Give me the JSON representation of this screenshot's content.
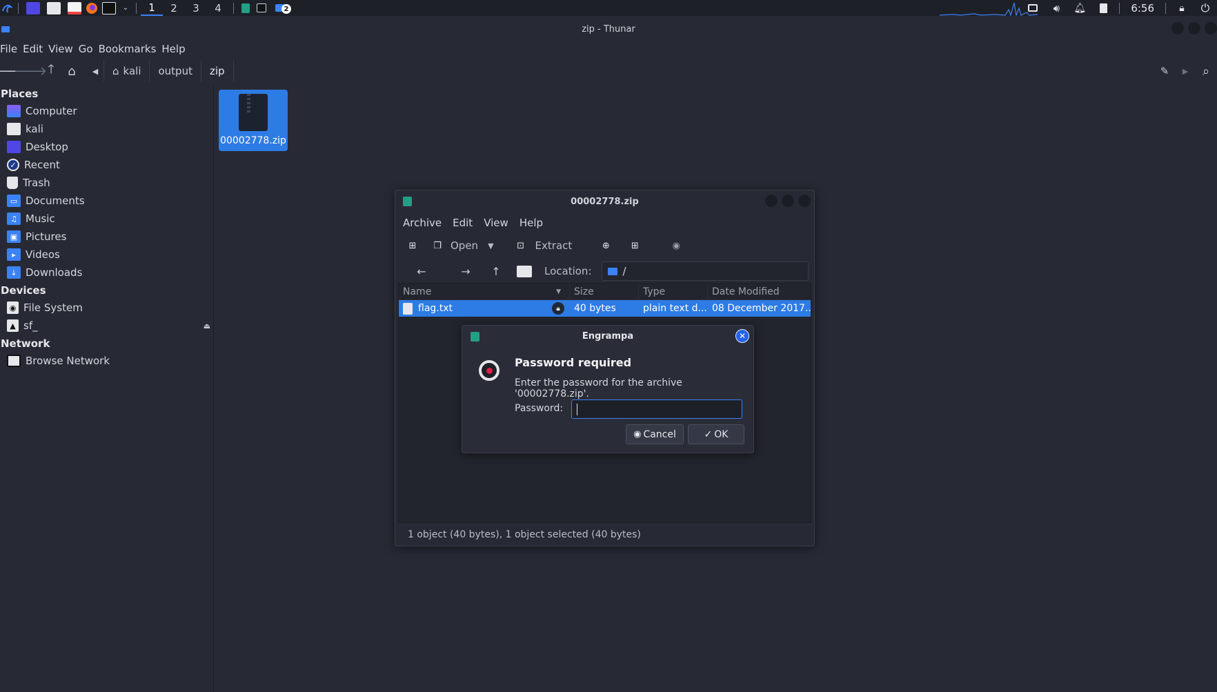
{
  "panel": {
    "workspaces": [
      "1",
      "2",
      "3",
      "4"
    ],
    "active_workspace": "1",
    "notification_badge": "2",
    "clock": "6:56",
    "accent": "#3b82f6"
  },
  "thunar": {
    "title": "zip - Thunar",
    "menu": [
      "File",
      "Edit",
      "View",
      "Go",
      "Bookmarks",
      "Help"
    ],
    "breadcrumbs": [
      "kali",
      "output",
      "zip"
    ],
    "sidebar": {
      "places_header": "Places",
      "places": [
        {
          "label": "Computer",
          "icon": "computer-icon"
        },
        {
          "label": "kali",
          "icon": "home-folder-icon"
        },
        {
          "label": "Desktop",
          "icon": "desktop-folder-icon"
        },
        {
          "label": "Recent",
          "icon": "recent-icon"
        },
        {
          "label": "Trash",
          "icon": "trash-icon"
        },
        {
          "label": "Documents",
          "icon": "documents-folder-icon"
        },
        {
          "label": "Music",
          "icon": "music-folder-icon"
        },
        {
          "label": "Pictures",
          "icon": "pictures-folder-icon"
        },
        {
          "label": "Videos",
          "icon": "videos-folder-icon"
        },
        {
          "label": "Downloads",
          "icon": "downloads-folder-icon"
        }
      ],
      "devices_header": "Devices",
      "devices": [
        {
          "label": "File System",
          "icon": "drive-icon"
        },
        {
          "label": "sf_",
          "icon": "shared-folder-icon"
        }
      ],
      "network_header": "Network",
      "network": [
        {
          "label": "Browse Network",
          "icon": "network-icon"
        }
      ]
    },
    "files": [
      {
        "name": "00002778.zip",
        "icon": "zip-archive-icon",
        "selected": true
      }
    ]
  },
  "engrampa": {
    "title": "00002778.zip",
    "menu": [
      "Archive",
      "Edit",
      "View",
      "Help"
    ],
    "toolbar": {
      "open_label": "Open",
      "extract_label": "Extract"
    },
    "location_label": "Location:",
    "location_value": "/",
    "columns": [
      "Name",
      "Size",
      "Type",
      "Date Modified"
    ],
    "rows": [
      {
        "name": "flag.txt",
        "size": "40 bytes",
        "type": "plain text d...",
        "date": "08 December 2017..."
      }
    ],
    "status": "1 object (40 bytes), 1 object selected (40 bytes)"
  },
  "dialog": {
    "title": "Engrampa",
    "heading": "Password required",
    "message": "Enter the password for the archive '00002778.zip'.",
    "password_label": "Password:",
    "password_value": "",
    "cancel_label": "Cancel",
    "ok_label": "OK"
  }
}
